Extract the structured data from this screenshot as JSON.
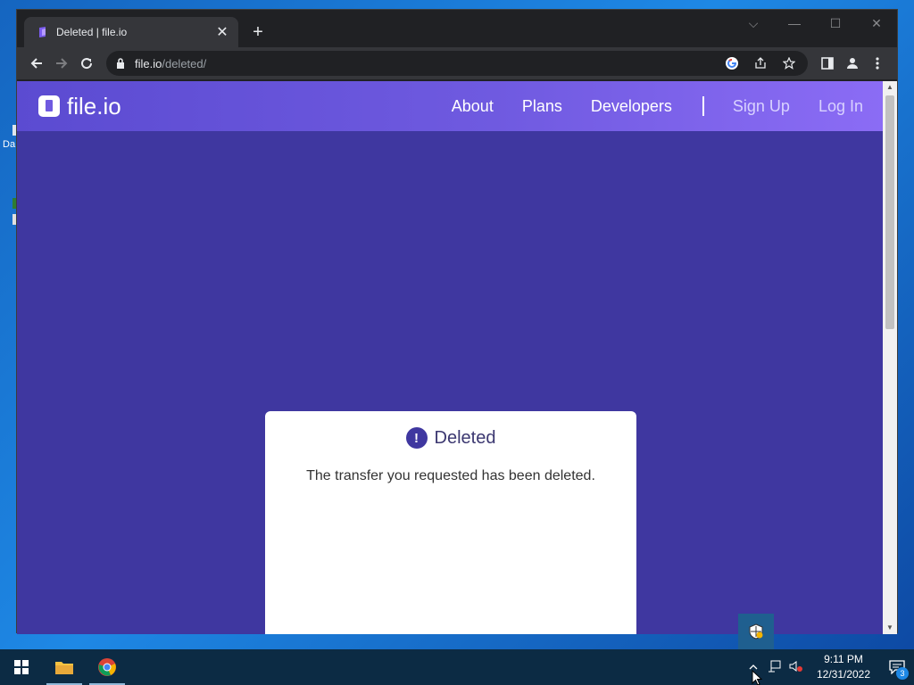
{
  "desktop": {
    "stub_label": "Da"
  },
  "browser": {
    "tab_title": "Deleted | file.io",
    "new_tab": "+",
    "url_host": "file.io",
    "url_path": "/deleted/",
    "window_controls": {
      "dropdown": "⌵",
      "minimize": "—",
      "maximize": "☐",
      "close": "✕"
    }
  },
  "site": {
    "brand": "file.io",
    "nav": {
      "about": "About",
      "plans": "Plans",
      "developers": "Developers",
      "signup": "Sign Up",
      "login": "Log In"
    }
  },
  "card": {
    "alert_symbol": "!",
    "title": "Deleted",
    "message": "The transfer you requested has been deleted."
  },
  "taskbar": {
    "time": "9:11 PM",
    "date": "12/31/2022",
    "notification_count": "3"
  },
  "colors": {
    "page_bg": "#3f37a0",
    "nav_gradient_start": "#5b4bd1",
    "nav_gradient_end": "#8b6cf5",
    "browser_chrome": "#35363a",
    "taskbar": "#0c2b44"
  }
}
